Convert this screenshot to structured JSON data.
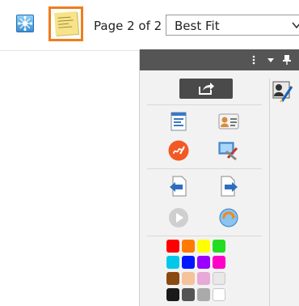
{
  "toolbar": {
    "network_icon": "network-node-icon",
    "sticky_icon": "sticky-note-icon",
    "page_indicator": "Page 2 of 2",
    "zoom": {
      "selected": "Best Fit",
      "icon": "chevron-down-icon"
    }
  },
  "panel": {
    "header_icons": [
      "more-vertical-icon",
      "dropdown-arrow-icon",
      "pin-icon"
    ],
    "share_icon": "share-export-icon",
    "tools": [
      [
        "form-fields-icon",
        "contact-card-icon"
      ],
      [
        "signature-icon",
        "settings-tools-icon"
      ],
      [
        "previous-page-icon",
        "next-page-icon"
      ],
      [
        "play-icon",
        "refresh-icon"
      ]
    ],
    "side_icon": "signer-icon",
    "palette": {
      "rows": [
        [
          "#ff0000",
          "#ff7a00",
          "#ffff00",
          "#22dd22"
        ],
        [
          "#00c8e8",
          "#0018ff",
          "#9a00ff",
          "#ff00c8"
        ],
        [
          "#8b4a12",
          "#f5c29a",
          "#e8a8d8",
          "#e8e8e8"
        ],
        [
          "#1a1a1a",
          "#555555",
          "#aaaaaa",
          "#ffffff"
        ]
      ]
    }
  }
}
